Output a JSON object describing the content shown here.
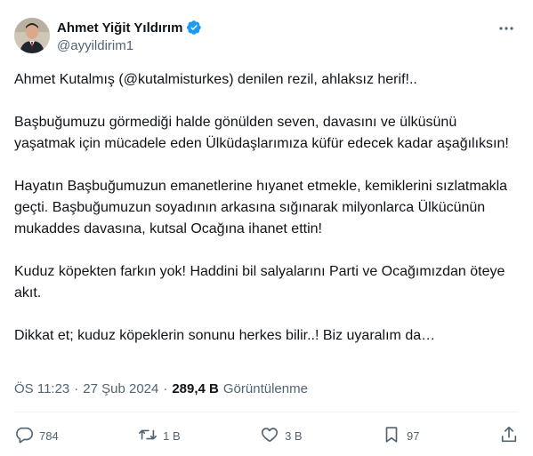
{
  "author": {
    "name": "Ahmet Yiğit Yıldırım",
    "handle": "@ayyildirim1"
  },
  "tweet": {
    "paragraphs": [
      "Ahmet Kutalmış (@kutalmisturkes) denilen rezil, ahlaksız herif!..",
      "Başbuğumuzu görmediği halde gönülden seven, davasını ve ülküsünü yaşatmak için mücadele eden Ülküdaşlarımıza küfür edecek kadar aşağılıksın!",
      "Hayatın Başbuğumuzun emanetlerine hıyanet etmekle, kemiklerini sızlatmakla geçti. Başbuğumuzun soyadının arkasına sığınarak milyonlarca Ülkücünün mukaddes davasına, kutsal Ocağına ihanet ettin!",
      "Kuduz köpekten farkın yok! Haddini bil salyalarını Parti ve Ocağımızdan öteye akıt.",
      "Dikkat et; kuduz köpeklerin sonunu herkes bilir..! Biz uyaralım da…"
    ]
  },
  "meta": {
    "time": "ÖS 11:23",
    "separator": "·",
    "date": "27 Şub 2024",
    "separator2": "·",
    "views_count": "289,4 B",
    "views_label": "Görüntülenme"
  },
  "actions": {
    "replies": "784",
    "retweets": "1 B",
    "likes": "3 B",
    "bookmarks": "97"
  },
  "colors": {
    "verified": "#1d9bf0",
    "secondary_text": "#536471",
    "divider": "#eff3f4"
  }
}
